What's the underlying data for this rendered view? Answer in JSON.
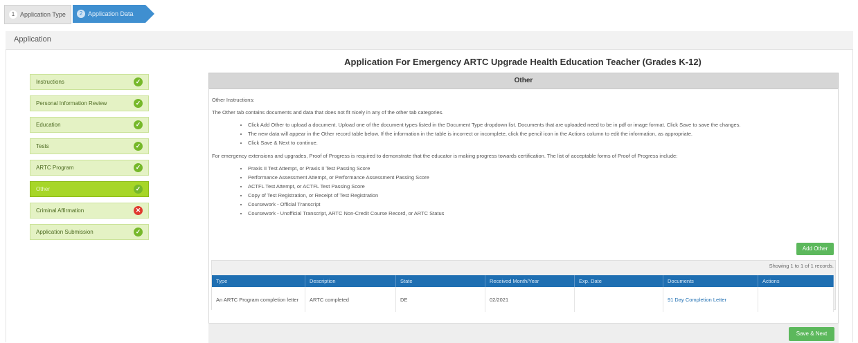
{
  "wizard": {
    "steps": [
      {
        "num": "1",
        "label": "Application Type"
      },
      {
        "num": "2",
        "label": "Application Data"
      }
    ]
  },
  "appbar": {
    "title": "Application"
  },
  "page": {
    "title": "Application For Emergency ARTC Upgrade Health Education Teacher (Grades K-12)"
  },
  "nav": {
    "items": [
      {
        "label": "Instructions",
        "status": "✓"
      },
      {
        "label": "Personal Information Review",
        "status": "✓"
      },
      {
        "label": "Education",
        "status": "✓"
      },
      {
        "label": "Tests",
        "status": "✓"
      },
      {
        "label": "ARTC Program",
        "status": "✓"
      },
      {
        "label": "Other",
        "status": "✓"
      },
      {
        "label": "Criminal Affirmation",
        "status": "✕"
      },
      {
        "label": "Application Submission",
        "status": "✓"
      }
    ]
  },
  "panel": {
    "header": "Other",
    "instructions_title": "Other Instructions:",
    "intro": "The Other tab contains documents and data that does not fit nicely in any of the other tab categories.",
    "bullets": [
      "Click Add Other to upload a document. Upload one of the document types listed in the Document Type dropdown list. Documents that are uploaded need to be in pdf or image format. Click Save to save the changes.",
      "The new data will appear in the Other record table below. If the information in the table is incorrect or incomplete, click the pencil icon in the Actions column to edit the information, as appropriate.",
      "Click Save & Next to continue."
    ],
    "progress_text": "For emergency extensions and upgrades, Proof of Progress is required to demonstrate that the educator is making progress towards certification. The list of acceptable forms of Proof of Progress include:",
    "progress_items": [
      "Praxis II Test Attempt, or Praxis II Test Passing Score",
      "Performance Assessment Attempt, or Performance Assessment Passing Score",
      "ACTFL Test Attempt, or ACTFL Test Passing Score",
      "Copy of Test Registration, or Receipt of Test Registration",
      "Coursework - Official Transcript",
      "Coursework - Unofficial Transcript, ARTC Non-Credit Course Record, or ARTC Status"
    ],
    "add_other": "Add Other",
    "records_info": "Showing 1 to 1 of 1 records."
  },
  "table": {
    "headers": [
      "Type",
      "Description",
      "State",
      "Received Month/Year",
      "Exp. Date",
      "Documents",
      "Actions"
    ],
    "rows": [
      [
        "An ARTC Program completion letter",
        "ARTC completed",
        "DE",
        "02/2021",
        "",
        "91 Day Completion Letter",
        ""
      ]
    ]
  },
  "footer": {
    "save_next": "Save & Next"
  },
  "colors": {
    "accent_blue": "#1f6fb2",
    "nav_active": "#a7d628",
    "nav_inactive": "#e4f2c4",
    "success_green": "#5cb85c",
    "error_red": "#e03a2f"
  }
}
